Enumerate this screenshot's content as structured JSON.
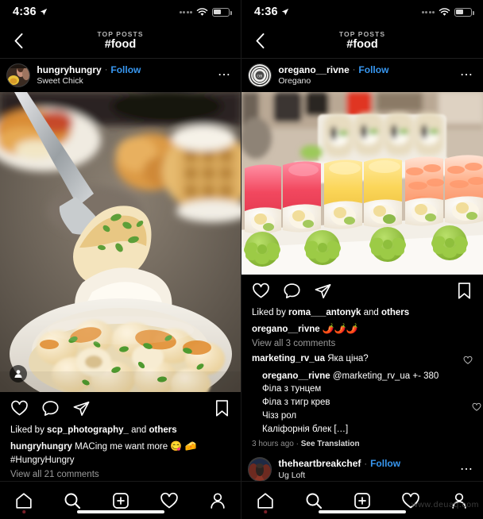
{
  "status_bar": {
    "time": "4:36",
    "location_icon": "location-arrow-icon",
    "signal_icon": "signal-dots-icon",
    "wifi_icon": "wifi-icon",
    "battery_icon": "battery-icon"
  },
  "nav": {
    "back_icon": "chevron-left-icon",
    "supertitle": "TOP POSTS",
    "title": "#food"
  },
  "left_panel": {
    "post": {
      "username": "hungryhungry",
      "separator": "·",
      "follow_label": "Follow",
      "location": "Sweet Chick",
      "more_icon": "kebab-menu-icon",
      "avatar_name": "avatar-hungryhungry",
      "tag_badge_icon": "person-tag-icon",
      "image_alt": "mac-and-cheese-photo"
    },
    "actions": {
      "like_icon": "heart-icon",
      "comment_icon": "speech-bubble-icon",
      "share_icon": "paper-plane-icon",
      "save_icon": "bookmark-icon"
    },
    "liked_by_prefix": "Liked by ",
    "liked_by_user": "scp_photography_",
    "liked_by_middle": " and ",
    "liked_by_others": "others",
    "caption_user": "hungryhungry",
    "caption_text": " MACing me want more ",
    "caption_emoji_1": "😋",
    "caption_emoji_2": "🧀",
    "caption_hashtag": "#HungryHungry",
    "view_all": "View all 21 comments"
  },
  "right_panel": {
    "post": {
      "username": "oregano__rivne",
      "separator": "·",
      "follow_label": "Follow",
      "location": "Oregano",
      "more_icon": "kebab-menu-icon",
      "avatar_name": "avatar-oregano-rivne",
      "image_alt": "sushi-rolls-platter-photo"
    },
    "actions": {
      "like_icon": "heart-icon",
      "comment_icon": "speech-bubble-icon",
      "share_icon": "paper-plane-icon",
      "save_icon": "bookmark-icon"
    },
    "liked_by_prefix": "Liked by ",
    "liked_by_user": "roma___antonyk",
    "liked_by_middle": " and ",
    "liked_by_others": "others",
    "caption_user": "oregano__rivne",
    "caption_emojis": "🌶️🌶️🌶️",
    "view_all": "View all 3 comments",
    "comments": [
      {
        "user": "marketing_rv_ua",
        "text": " Яка ціна?",
        "like_icon": "heart-icon"
      }
    ],
    "reply": {
      "user": "oregano__rivne",
      "first_line": " @marketing_rv_ua +- 380",
      "lines": [
        "Філа з тунцем",
        "Філа з тигр крев",
        "Чізз рол",
        "Каліфорнія блек […]"
      ],
      "like_icon": "heart-icon"
    },
    "timestamp": "3 hours ago",
    "time_separator": " · ",
    "see_translation": "See Translation",
    "next_post": {
      "username": "theheartbreakchef",
      "separator": "·",
      "follow_label": "Follow",
      "location": "Ug Loft",
      "more_icon": "kebab-menu-icon",
      "avatar_name": "avatar-theheartbreakchef"
    }
  },
  "tabbar": {
    "items": [
      {
        "icon": "home-icon",
        "name": "tab-home",
        "active": true
      },
      {
        "icon": "search-icon",
        "name": "tab-search",
        "active": false
      },
      {
        "icon": "plus-square-icon",
        "name": "tab-create",
        "active": false
      },
      {
        "icon": "heart-icon",
        "name": "tab-activity",
        "active": false
      },
      {
        "icon": "person-icon",
        "name": "tab-profile",
        "active": false
      }
    ]
  },
  "watermark": "www.deuaq.com",
  "colors": {
    "background": "#000000",
    "accent_blue": "#3897f0",
    "muted_text": "#8e8e8e",
    "white": "#ffffff"
  }
}
